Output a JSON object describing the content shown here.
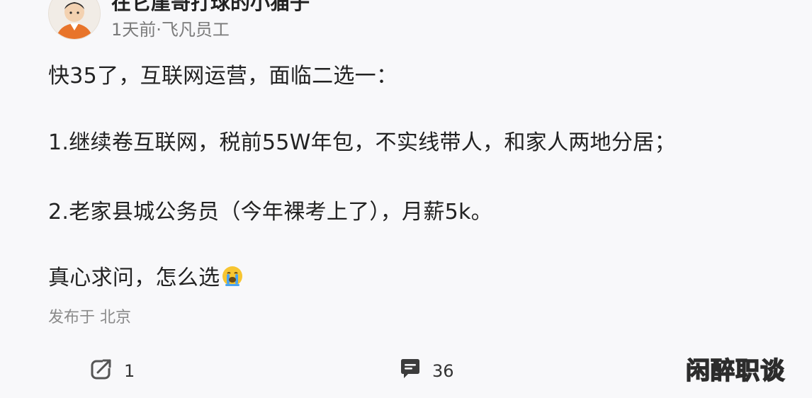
{
  "author": {
    "name": "在它崖哥打球的小猫子",
    "meta": "1天前·飞凡员工"
  },
  "post": {
    "paragraphs": [
      "快35了，互联网运营，面临二选一：",
      "1.继续卷互联网，税前55W年包，不实线带人，和家人两地分居；",
      "2.老家县城公务员（今年裸考上了），月薪5k。",
      "真心求问，怎么选"
    ],
    "emoji": "crying-face-emoji",
    "location": "发布于 北京"
  },
  "actions": {
    "share_count": "1",
    "comment_count": "36"
  },
  "watermark": "闲醉职谈",
  "colors": {
    "background": "#f8f8fa",
    "text": "#222222",
    "muted": "#7a7a7a",
    "avatar_jacket": "#e8742a"
  },
  "icons": {
    "share": "share-icon",
    "comment": "comment-icon"
  }
}
